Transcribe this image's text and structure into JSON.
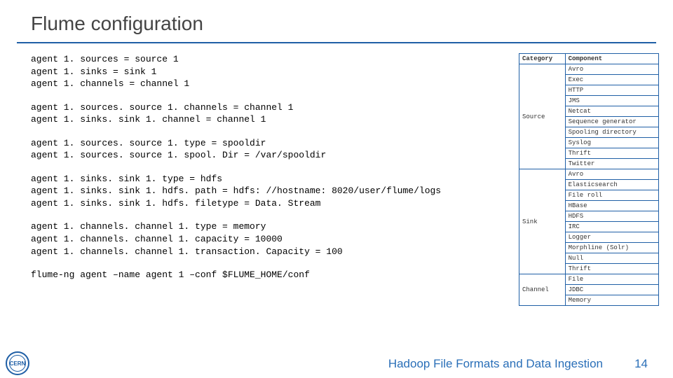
{
  "title": "Flume configuration",
  "code_blocks": [
    "agent 1. sources = source 1\nagent 1. sinks = sink 1\nagent 1. channels = channel 1",
    "agent 1. sources. source 1. channels = channel 1\nagent 1. sinks. sink 1. channel = channel 1",
    "agent 1. sources. source 1. type = spooldir\nagent 1. sources. source 1. spool. Dir = /var/spooldir",
    "agent 1. sinks. sink 1. type = hdfs\nagent 1. sinks. sink 1. hdfs. path = hdfs: //hostname: 8020/user/flume/logs\nagent 1. sinks. sink 1. hdfs. filetype = Data. Stream",
    "agent 1. channels. channel 1. type = memory\nagent 1. channels. channel 1. capacity = 10000\nagent 1. channels. channel 1. transaction. Capacity = 100",
    "flume-ng agent –name agent 1 –conf $FLUME_HOME/conf"
  ],
  "table": {
    "headers": {
      "col1": "Category",
      "col2": "Component"
    },
    "groups": [
      {
        "category": "Source",
        "components": [
          "Avro",
          "Exec",
          "HTTP",
          "JMS",
          "Netcat",
          "Sequence generator",
          "Spooling directory",
          "Syslog",
          "Thrift",
          "Twitter"
        ]
      },
      {
        "category": "Sink",
        "components": [
          "Avro",
          "Elasticsearch",
          "File roll",
          "HBase",
          "HDFS",
          "IRC",
          "Logger",
          "Morphline (Solr)",
          "Null",
          "Thrift"
        ]
      },
      {
        "category": "Channel",
        "components": [
          "File",
          "JDBC",
          "Memory"
        ]
      }
    ]
  },
  "footer": {
    "title": "Hadoop File Formats and Data Ingestion",
    "page": "14",
    "logo": "CERN"
  }
}
